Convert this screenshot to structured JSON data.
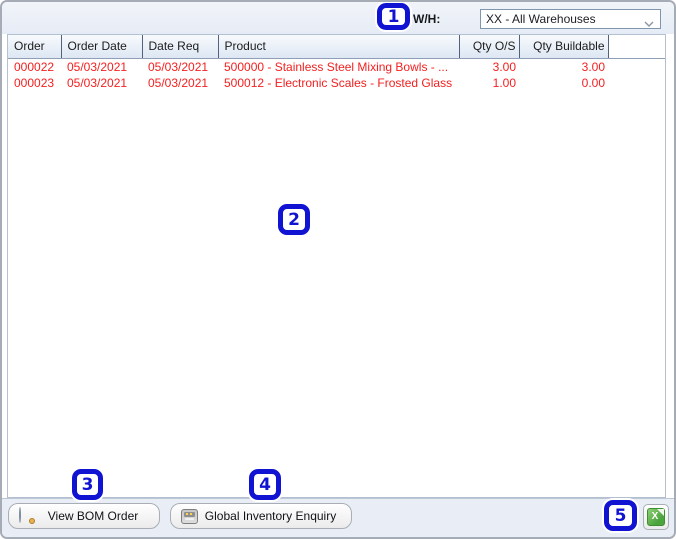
{
  "header": {
    "warehouse_label": "W/H:",
    "warehouse_value": "XX - All Warehouses"
  },
  "callouts": {
    "c1": "1",
    "c2": "2",
    "c3": "3",
    "c4": "4",
    "c5": "5"
  },
  "table": {
    "columns": [
      "Order",
      "Order Date",
      "Date Req",
      "Product",
      "Qty O/S",
      "Qty Buildable"
    ],
    "rows": [
      [
        "000022",
        "05/03/2021",
        "05/03/2021",
        "500000 - Stainless Steel Mixing Bowls - ...",
        "3.00",
        "3.00"
      ],
      [
        "000023",
        "05/03/2021",
        "05/03/2021",
        "500012 - Electronic Scales - Frosted Glass",
        "1.00",
        "0.00"
      ]
    ]
  },
  "footer": {
    "view_bom_label": "View BOM Order",
    "global_inventory_label": "Global Inventory Enquiry",
    "excel_glyph": "X"
  },
  "icons": {
    "combo_chevron": "chevron-down-icon",
    "view_bom": "magnifier-icon",
    "global_inventory": "inventory-drawer-icon",
    "excel_export": "excel-export-icon"
  },
  "colors": {
    "callout_blue": "#1113d2",
    "row_text_red": "#f51f1f",
    "header_bg_top": "#f8fafd",
    "header_bg_bottom": "#dde7f3",
    "strip_bg": "#e9eef6",
    "combo_border": "#7f96ad"
  }
}
